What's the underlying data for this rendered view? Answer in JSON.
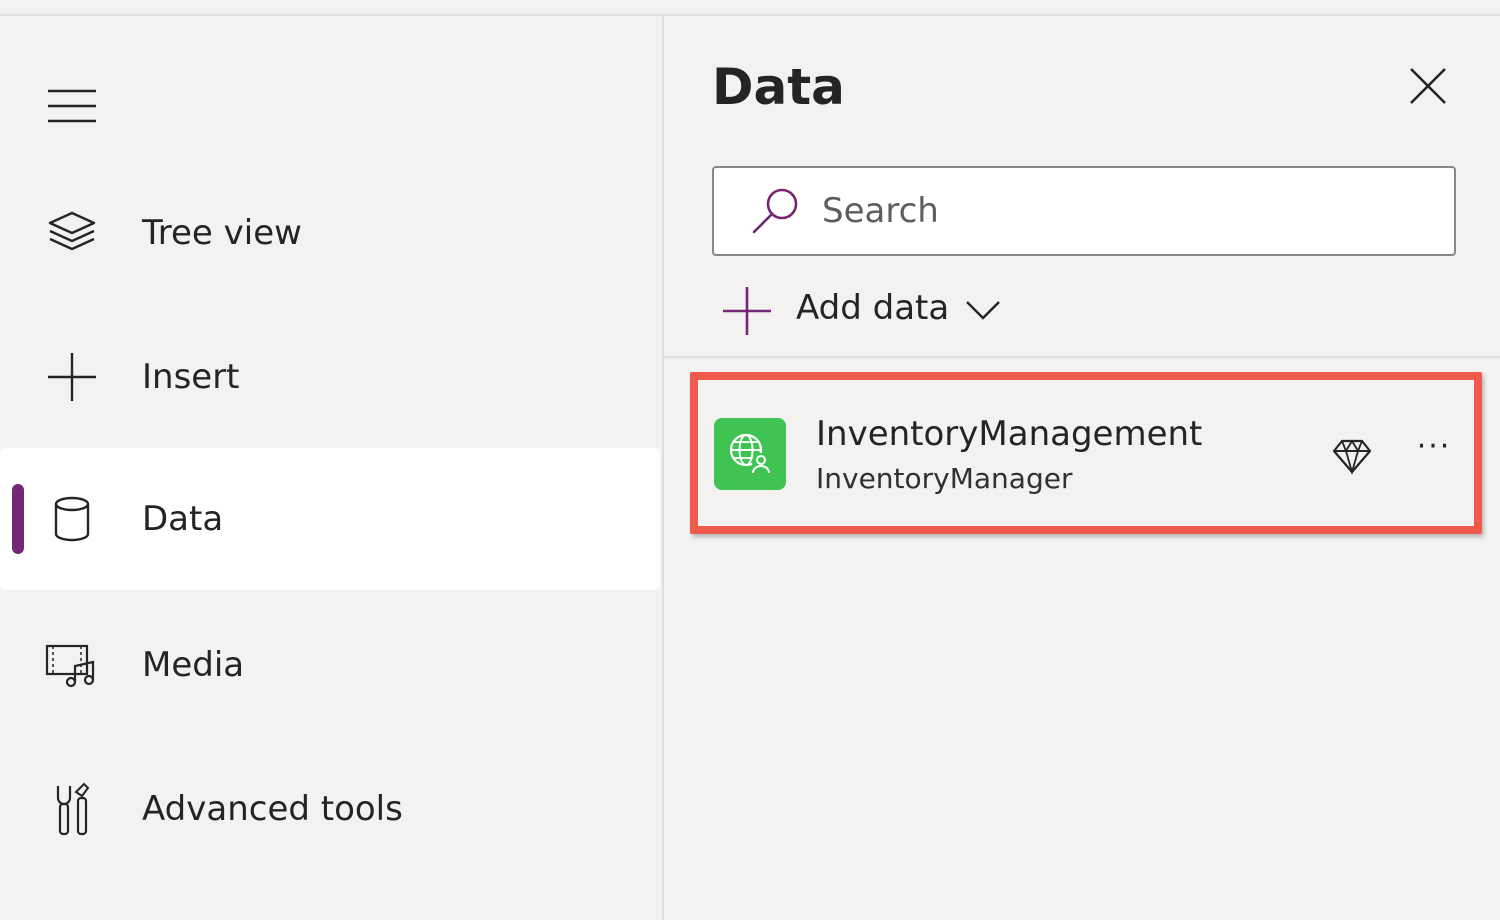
{
  "rail": {
    "items": [
      {
        "label": "Tree view",
        "icon": "layers-icon",
        "selected": false
      },
      {
        "label": "Insert",
        "icon": "plus-icon",
        "selected": false
      },
      {
        "label": "Data",
        "icon": "database-icon",
        "selected": true
      },
      {
        "label": "Media",
        "icon": "media-icon",
        "selected": false
      },
      {
        "label": "Advanced tools",
        "icon": "tools-icon",
        "selected": false
      }
    ],
    "accent_color": "#742774"
  },
  "pane": {
    "title": "Data",
    "search": {
      "placeholder": "Search",
      "value": ""
    },
    "add_data_label": "Add data",
    "sources": [
      {
        "name": "InventoryManagement",
        "subtitle": "InventoryManager",
        "icon": "globe-user-icon",
        "icon_color": "#3fc453",
        "premium": true
      }
    ],
    "highlight_color": "#ef5a4c"
  }
}
